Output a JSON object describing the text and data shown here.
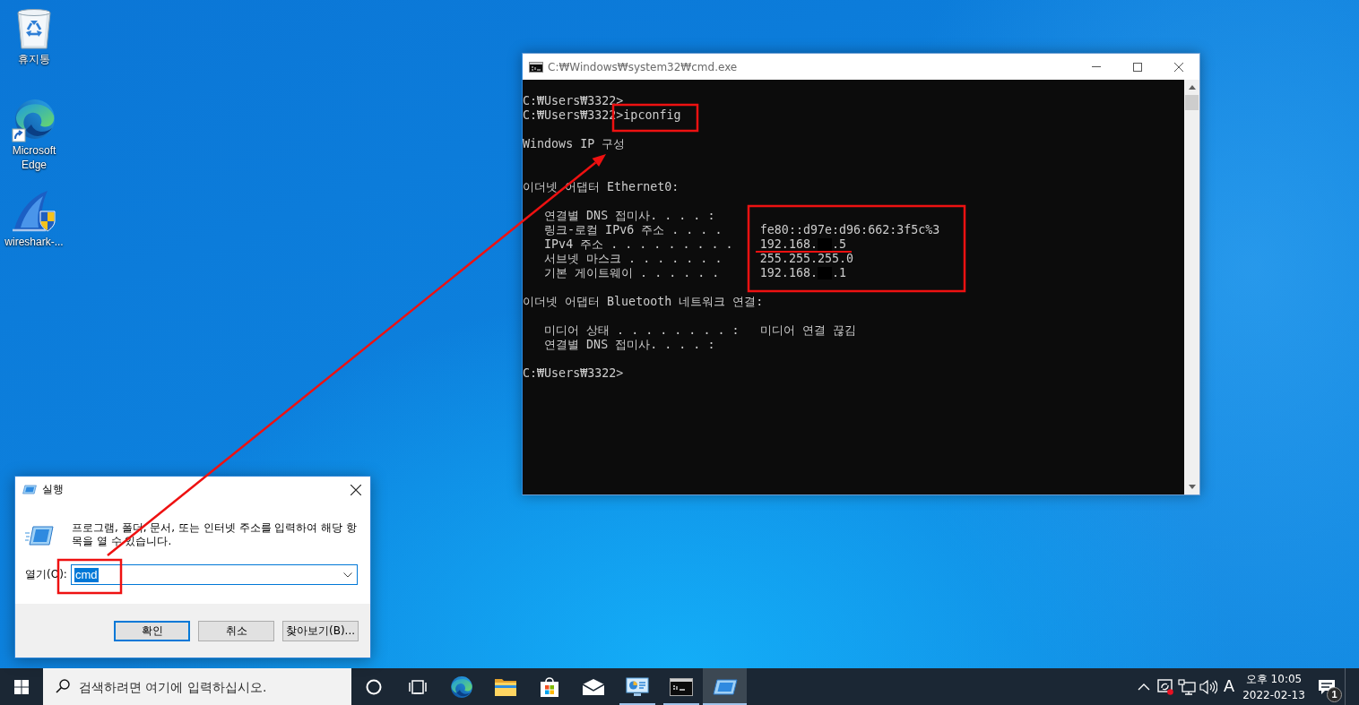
{
  "desktop_icons": [
    {
      "kind": "recycle_bin",
      "label": "휴지통"
    },
    {
      "kind": "browser",
      "label": "Microsoft Edge"
    },
    {
      "kind": "installer",
      "label": "wireshark-..."
    }
  ],
  "console_window": {
    "title": "C:₩Windows₩system32₩cmd.exe",
    "blocks": [
      [
        {
          "kind": "text",
          "text": "C:₩Users₩3322>"
        },
        {
          "kind": "text",
          "text": "C:₩Users₩3322>ipconfig"
        }
      ],
      [
        {
          "kind": "title",
          "text": "Windows IP 구성"
        }
      ],
      [
        {
          "kind": "text",
          "text": "이더넷 어댑터 Ethernet0:"
        }
      ],
      [
        {
          "kind": "entry",
          "label": "연결별 DNS 접미사. . . . :",
          "redacted": false
        },
        {
          "kind": "entry",
          "label": "링크-로컬 IPv6 주소 . . . .",
          "value": "fe80::d97e:d96:662:3f5c%3",
          "redacted": false
        },
        {
          "kind": "entry",
          "label": "IPv4 주소 . . . . . . . . .",
          "value": "192.168.",
          "redacted": true,
          "value_after": ".5"
        },
        {
          "kind": "entry",
          "label": "서브넷 마스크 . . . . . . .",
          "value": "255.255.255.0",
          "redacted": false
        },
        {
          "kind": "entry",
          "label": "기본 게이트웨이 . . . . . .",
          "value": "192.168.",
          "redacted": true,
          "value_after": ".1"
        }
      ],
      [
        {
          "kind": "text",
          "text": "이더넷 어댑터 Bluetooth 네트워크 연결:"
        }
      ],
      [
        {
          "kind": "entry",
          "label": "미디어 상태 . . . . . . . . :",
          "value": "미디어 연결 끊김",
          "redacted": false
        },
        {
          "kind": "entry",
          "label": "연결별 DNS 접미사. . . . :",
          "redacted": false
        }
      ],
      [
        {
          "kind": "text",
          "text": "C:₩Users₩3322>"
        }
      ]
    ]
  },
  "run_dialog": {
    "title": "실행",
    "description": "프로그램, 폴더, 문서, 또는 인터넷 주소를 입력하여 해당 항목을 열 수 있습니다.",
    "open_label": "열기(O):",
    "open_value": "cmd",
    "value_selected": true,
    "buttons": [
      {
        "label": "확인",
        "default": true
      },
      {
        "label": "취소",
        "default": false
      },
      {
        "label": "찾아보기(B)...",
        "default": false
      }
    ]
  },
  "taskbar": {
    "search_placeholder": "검색하려면 여기에 입력하십시오.",
    "apps": [
      {
        "kind": "cortana",
        "running": false,
        "active": false
      },
      {
        "kind": "taskview",
        "running": false,
        "active": false
      },
      {
        "kind": "browser",
        "running": false,
        "active": false
      },
      {
        "kind": "files",
        "running": false,
        "active": false
      },
      {
        "kind": "store",
        "running": false,
        "active": false
      },
      {
        "kind": "mail",
        "running": false,
        "active": false
      },
      {
        "kind": "monitor",
        "running": true,
        "active": false
      },
      {
        "kind": "terminal",
        "running": true,
        "active": false
      },
      {
        "kind": "run",
        "running": true,
        "active": true
      }
    ],
    "ime": "A",
    "time": "오후 10:05",
    "date": "2022-02-13",
    "notification_count": "1"
  },
  "annotations": [
    {
      "kind": "box"
    },
    {
      "kind": "box"
    },
    {
      "kind": "underline"
    },
    {
      "kind": "box"
    },
    {
      "kind": "arrow"
    }
  ]
}
